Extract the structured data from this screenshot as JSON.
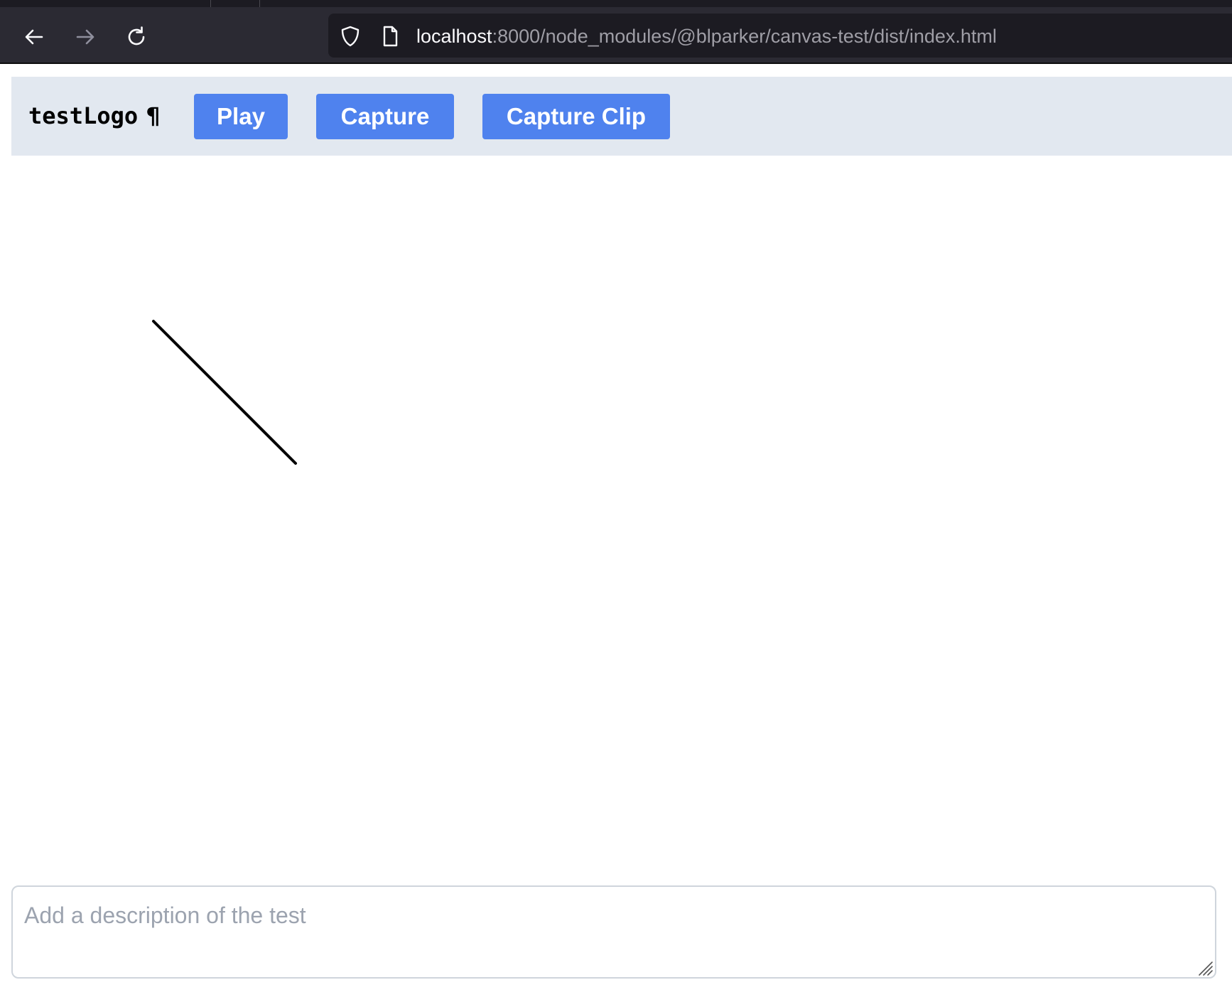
{
  "browser": {
    "url_host": "localhost",
    "url_path": ":8000/node_modules/@blparker/canvas-test/dist/index.html",
    "icons": {
      "back": "back-arrow-icon",
      "forward": "forward-arrow-icon",
      "reload": "reload-icon",
      "shield": "shield-icon",
      "page": "page-icon"
    }
  },
  "header": {
    "test_name": "testLogo",
    "pilcrow": "¶",
    "buttons": {
      "play": "Play",
      "capture": "Capture",
      "capture_clip": "Capture Clip"
    }
  },
  "description": {
    "placeholder": "Add a description of the test",
    "value": ""
  },
  "colors": {
    "button_bg": "#4f82ee",
    "header_bg": "#e2e8f0",
    "chrome_bg": "#2b2a33",
    "stroke": "#000000"
  }
}
